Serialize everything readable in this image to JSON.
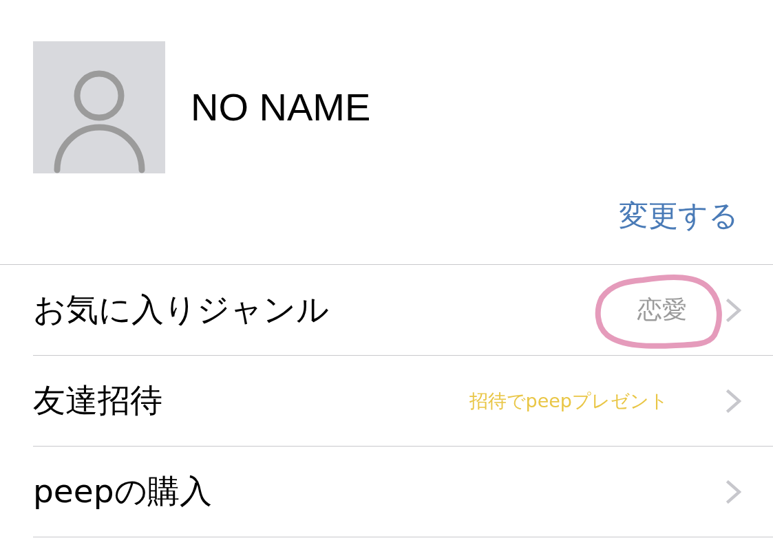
{
  "profile": {
    "name": "NO NAME",
    "edit_link": "変更する"
  },
  "menu_rows": [
    {
      "label": "お気に入りジャンル",
      "value": {
        "text": "恋愛",
        "kind": "detail",
        "circled": true
      }
    },
    {
      "label": "友達招待",
      "value": {
        "text": "招待でpeepプレゼント",
        "kind": "promo",
        "circled": false
      }
    },
    {
      "label": "peepの購入"
    }
  ]
}
